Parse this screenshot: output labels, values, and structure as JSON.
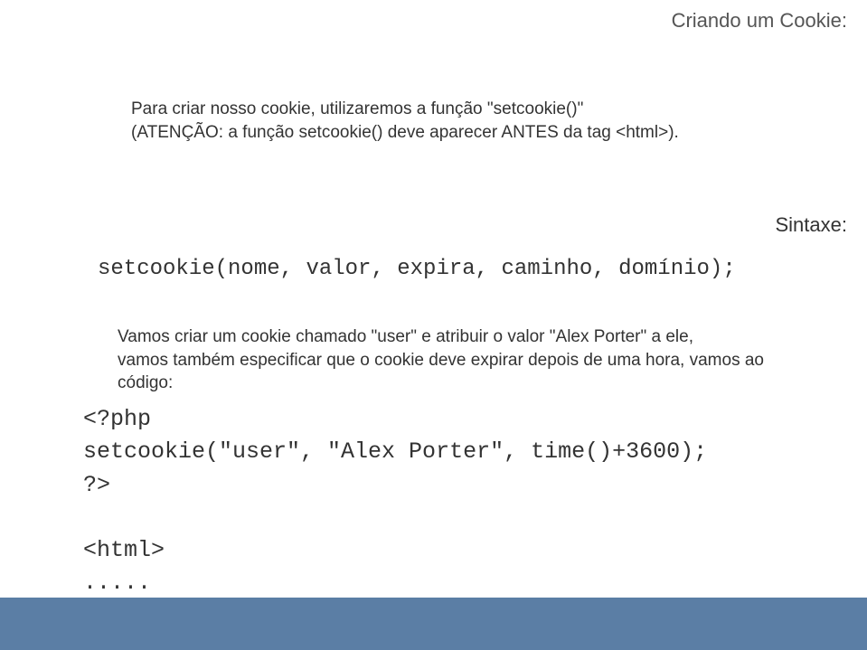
{
  "header": {
    "title": "Criando um Cookie:"
  },
  "intro": {
    "line1": "Para criar nosso cookie, utilizaremos a função \"setcookie()\"",
    "line2": "(ATENÇÃO: a função setcookie() deve aparecer ANTES da tag <html>)."
  },
  "syntax": {
    "label": "Sintaxe:",
    "code": "setcookie(nome, valor, expira, caminho, domínio);"
  },
  "example": {
    "line1": "Vamos criar um cookie chamado \"user\" e atribuir o valor \"Alex Porter\" a ele,",
    "line2": "vamos também especificar que o cookie deve expirar depois de uma hora, vamos ao código:"
  },
  "code": {
    "line1": "<?php",
    "line2": "setcookie(\"user\", \"Alex Porter\", time()+3600);",
    "line3": "?>",
    "line4": "",
    "line5": "<html>",
    "line6": "....."
  }
}
